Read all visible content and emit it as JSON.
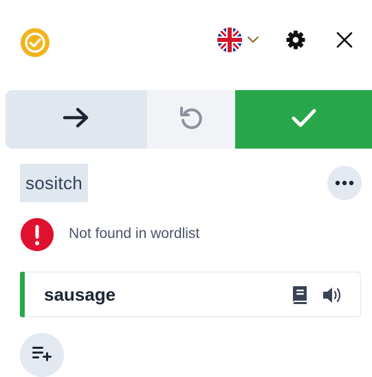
{
  "header": {
    "logo_icon": "check-badge-icon",
    "language_icon": "uk-flag-icon",
    "language_chevron_icon": "chevron-down-icon",
    "settings_icon": "gear-icon",
    "close_icon": "close-icon"
  },
  "actions": {
    "next_icon": "arrow-right-icon",
    "undo_icon": "undo-icon",
    "accept_icon": "checkmark-icon"
  },
  "entry": {
    "word": "sositch",
    "more_icon": "more-dots-icon"
  },
  "status": {
    "icon": "exclamation-icon",
    "text": "Not found in wordlist"
  },
  "suggestion": {
    "word": "sausage",
    "dictionary_icon": "book-icon",
    "audio_icon": "speaker-icon"
  },
  "footer": {
    "add_to_list_icon": "add-to-list-icon"
  },
  "colors": {
    "accent_green": "#27a749",
    "logo_yellow": "#f2b41c",
    "alert_red": "#e0102f",
    "segment_light": "#e1e7ef"
  }
}
